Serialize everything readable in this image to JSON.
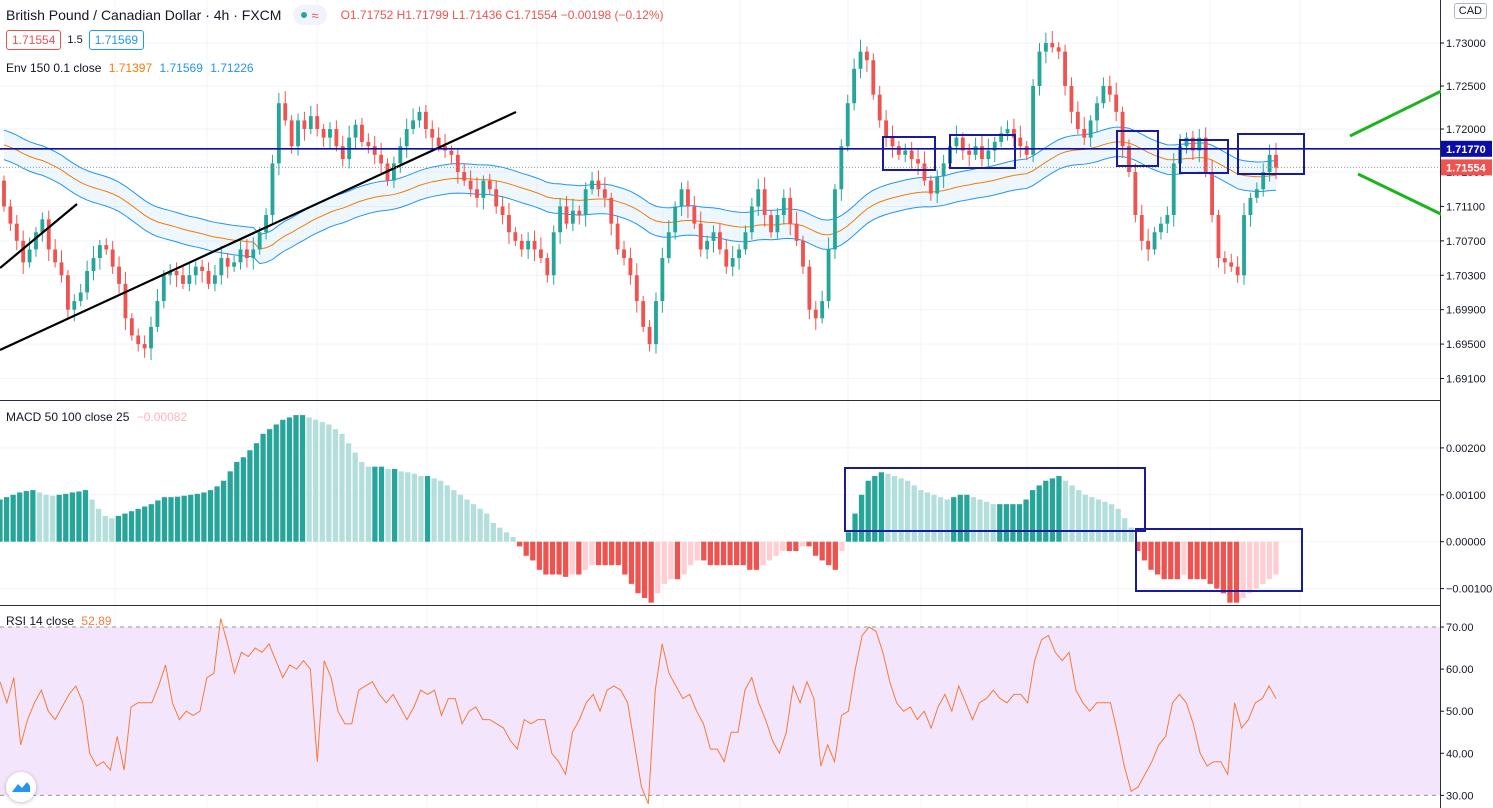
{
  "header": {
    "symbol": "British Pound / Canadian Dollar · 4h · FXCM",
    "ohlc": "O1.71752  H1.71799  L1.71436  C1.71554  −0.00198 (−0.12%)",
    "sell_price": "1.71554",
    "spread": "1.5",
    "buy_price": "1.71569",
    "currency": "CAD"
  },
  "indicators": {
    "env": {
      "name": "Env 150 0.1 close",
      "v1": "1.71397",
      "v2": "1.71569",
      "v3": "1.71226"
    },
    "macd": {
      "name": "MACD 50 100 close 25",
      "value": "−0.00082"
    },
    "rsi": {
      "name": "RSI 14 close",
      "value": "52.89"
    }
  },
  "colors": {
    "up": "#26a69a",
    "down": "#ef5350",
    "up_light": "#b2dfdb",
    "down_light": "#ffcdd2",
    "env_mid": "#f57c00",
    "env_band": "#2196f3",
    "hline": "#0c0ca8",
    "box": "#1a1a9c",
    "trend": "#000000",
    "arrow": "#1bb51b",
    "rsi": "#f57c3c",
    "rsi_bg": "#f3e5fb"
  },
  "chart_data": [
    {
      "type": "candlestick",
      "title": "British Pound / Canadian Dollar · 4h · FXCM",
      "ylim": [
        1.6885,
        1.735
      ],
      "y_ticks": [
        "1.73000",
        "1.72500",
        "1.72000",
        "1.71500",
        "1.71100",
        "1.70700",
        "1.70300",
        "1.69900",
        "1.69500",
        "1.69100"
      ],
      "y_tick_values": [
        1.73,
        1.725,
        1.72,
        1.715,
        1.711,
        1.707,
        1.703,
        1.699,
        1.695,
        1.691
      ],
      "price_labels": [
        {
          "value": 1.7177,
          "text": "1.71770"
        },
        {
          "value": 1.71554,
          "text": "1.71554"
        }
      ],
      "candles_close": [
        1.711,
        1.709,
        1.707,
        1.7045,
        1.706,
        1.708,
        1.7095,
        1.706,
        1.7045,
        1.703,
        1.699,
        1.7,
        1.701,
        1.7035,
        1.705,
        1.7065,
        1.706,
        1.704,
        1.702,
        1.698,
        1.696,
        1.695,
        1.6945,
        1.697,
        1.7,
        1.703,
        1.7035,
        1.703,
        1.702,
        1.703,
        1.704,
        1.7035,
        1.702,
        1.703,
        1.705,
        1.704,
        1.7045,
        1.706,
        1.705,
        1.706,
        1.708,
        1.71,
        1.716,
        1.723,
        1.721,
        1.718,
        1.721,
        1.72,
        1.7215,
        1.72,
        1.719,
        1.72,
        1.718,
        1.7165,
        1.719,
        1.7205,
        1.7185,
        1.718,
        1.717,
        1.716,
        1.714,
        1.716,
        1.718,
        1.72,
        1.721,
        1.722,
        1.72,
        1.719,
        1.718,
        1.7175,
        1.717,
        1.715,
        1.714,
        1.713,
        1.712,
        1.714,
        1.713,
        1.711,
        1.71,
        1.708,
        1.707,
        1.706,
        1.707,
        1.706,
        1.705,
        1.703,
        1.708,
        1.711,
        1.709,
        1.7105,
        1.71,
        1.713,
        1.714,
        1.713,
        1.712,
        1.709,
        1.706,
        1.705,
        1.703,
        1.7,
        1.697,
        1.695,
        1.7,
        1.705,
        1.708,
        1.711,
        1.713,
        1.711,
        1.709,
        1.706,
        1.707,
        1.708,
        1.706,
        1.704,
        1.705,
        1.706,
        1.708,
        1.711,
        1.713,
        1.71,
        1.708,
        1.71,
        1.712,
        1.709,
        1.707,
        1.704,
        1.699,
        1.698,
        1.7,
        1.706,
        1.713,
        1.718,
        1.723,
        1.727,
        1.729,
        1.728,
        1.724,
        1.721,
        1.719,
        1.718,
        1.717,
        1.7175,
        1.7165,
        1.716,
        1.714,
        1.7125,
        1.7145,
        1.716,
        1.718,
        1.719,
        1.7175,
        1.717,
        1.718,
        1.7165,
        1.7175,
        1.7185,
        1.7195,
        1.72,
        1.719,
        1.718,
        1.717,
        1.725,
        1.729,
        1.73,
        1.7295,
        1.729,
        1.725,
        1.722,
        1.72,
        1.719,
        1.721,
        1.723,
        1.725,
        1.724,
        1.722,
        1.718,
        1.715,
        1.71,
        1.707,
        1.706,
        1.708,
        1.709,
        1.71,
        1.716,
        1.718,
        1.719,
        1.7175,
        1.719,
        1.715,
        1.71,
        1.705,
        1.7045,
        1.704,
        1.703,
        1.71,
        1.712,
        1.713,
        1.715,
        1.717,
        1.7155
      ],
      "envelope": {
        "ylim_text": "1.71397 / 1.71569 / 1.71226"
      },
      "annotations": [
        "horizontal line at 1.71770",
        "up trend lines",
        "consolidation boxes",
        "two green direction arrows"
      ]
    },
    {
      "type": "bar",
      "title": "MACD 50 100 close 25",
      "ylim": [
        -0.00135,
        0.003
      ],
      "y_ticks": [
        "0.00200",
        "0.00100",
        "0.00000",
        "−0.00100"
      ],
      "y_tick_values": [
        0.002,
        0.001,
        0.0,
        -0.001
      ],
      "values": [
        0.0009,
        0.00095,
        0.001,
        0.00105,
        0.00108,
        0.0011,
        0.00105,
        0.001,
        0.00098,
        0.001,
        0.00102,
        0.00105,
        0.00107,
        0.0011,
        0.0009,
        0.0007,
        0.00055,
        0.0005,
        0.00055,
        0.0006,
        0.00065,
        0.0007,
        0.00075,
        0.0008,
        0.00088,
        0.00095,
        0.00095,
        0.00096,
        0.00098,
        0.001,
        0.00102,
        0.00105,
        0.0011,
        0.00118,
        0.0013,
        0.0015,
        0.0017,
        0.0018,
        0.00195,
        0.0021,
        0.0023,
        0.0024,
        0.0025,
        0.0026,
        0.00265,
        0.0027,
        0.0027,
        0.00265,
        0.0026,
        0.00255,
        0.0025,
        0.0024,
        0.0023,
        0.0021,
        0.0019,
        0.0017,
        0.0016,
        0.0016,
        0.0016,
        0.00155,
        0.00155,
        0.0015,
        0.00148,
        0.00145,
        0.0014,
        0.0014,
        0.00135,
        0.0013,
        0.0012,
        0.0011,
        0.001,
        0.0009,
        0.0008,
        0.0007,
        0.0006,
        0.0004,
        0.0003,
        0.0002,
        0.0001,
        -0.0001,
        -0.0003,
        -0.0004,
        -0.0006,
        -0.0007,
        -0.0007,
        -0.0007,
        -0.00075,
        -0.0007,
        -0.0007,
        -0.0006,
        -0.0005,
        -0.0005,
        -0.0005,
        -0.0005,
        -0.0005,
        -0.0007,
        -0.0009,
        -0.0011,
        -0.0012,
        -0.0013,
        -0.0011,
        -0.0009,
        -0.0008,
        -0.0008,
        -0.0007,
        -0.0005,
        -0.0004,
        -0.0004,
        -0.0005,
        -0.0005,
        -0.0005,
        -0.0005,
        -0.0005,
        -0.0005,
        -0.0006,
        -0.0006,
        -0.0005,
        -0.0004,
        -0.0003,
        -0.0002,
        -0.0002,
        -0.0002,
        -0.0001,
        -0.0001,
        -0.0003,
        -0.0004,
        -0.0005,
        -0.0006,
        -0.0002,
        0.0002,
        0.0006,
        0.001,
        0.0013,
        0.0014,
        0.00148,
        0.00145,
        0.0014,
        0.00135,
        0.0013,
        0.0012,
        0.0011,
        0.00105,
        0.001,
        0.00095,
        0.0009,
        0.00095,
        0.001,
        0.001,
        0.00095,
        0.0009,
        0.00085,
        0.0008,
        0.0008,
        0.0008,
        0.0008,
        0.0008,
        0.0009,
        0.0011,
        0.0012,
        0.0013,
        0.00135,
        0.0014,
        0.0013,
        0.0012,
        0.0011,
        0.001,
        0.00095,
        0.0009,
        0.00085,
        0.0008,
        0.0007,
        0.0005,
        0.0003,
        -0.0002,
        -0.0004,
        -0.0006,
        -0.0007,
        -0.0008,
        -0.0008,
        -0.0008,
        -0.0007,
        -0.0008,
        -0.0008,
        -0.0008,
        -0.0009,
        -0.001,
        -0.0011,
        -0.0013,
        -0.0013,
        -0.0012,
        -0.0011,
        -0.001,
        -0.0009,
        -0.0008,
        -0.0007
      ]
    },
    {
      "type": "line",
      "title": "RSI 14 close",
      "ylim": [
        27,
        75
      ],
      "y_ticks": [
        "70.00",
        "60.00",
        "50.00",
        "40.00",
        "30.00"
      ],
      "y_tick_values": [
        70,
        60,
        50,
        40,
        30
      ],
      "band": [
        30,
        70
      ],
      "values": [
        57,
        52,
        58,
        42,
        48,
        52,
        55,
        50,
        48,
        51,
        54,
        56,
        52,
        40,
        37,
        38,
        36,
        44,
        36,
        51,
        52,
        52,
        52,
        56,
        61,
        52,
        48,
        50,
        49,
        50,
        58,
        59,
        72,
        66,
        59,
        64,
        63,
        65,
        64,
        66,
        62,
        58,
        61,
        60,
        62,
        60,
        38,
        62,
        58,
        50,
        47,
        47,
        55,
        56,
        57,
        54,
        52,
        54,
        51,
        48,
        51,
        55,
        54,
        55,
        49,
        53,
        53,
        47,
        50,
        51,
        48,
        48,
        47,
        46,
        43,
        41,
        48,
        47,
        48,
        48,
        40,
        38,
        35,
        45,
        48,
        52,
        54,
        50,
        55,
        56,
        55,
        52,
        42,
        32,
        28,
        55,
        66,
        59,
        56,
        53,
        54,
        50,
        47,
        41,
        41,
        38,
        45,
        45,
        55,
        58,
        52,
        48,
        43,
        40,
        45,
        56,
        52,
        57,
        53,
        37,
        42,
        38,
        49,
        50,
        60,
        68,
        70,
        69,
        64,
        57,
        52,
        50,
        51,
        48,
        50,
        46,
        51,
        54,
        50,
        56,
        52,
        48,
        52,
        53,
        55,
        53,
        52,
        54,
        54,
        52,
        62,
        67,
        68,
        64,
        62,
        64,
        55,
        52,
        50,
        52,
        52,
        52,
        45,
        37,
        31,
        32,
        35,
        38,
        42,
        44,
        52,
        54,
        52,
        47,
        40,
        37,
        38,
        38,
        35,
        52,
        46,
        48,
        52,
        53,
        56,
        53
      ]
    }
  ]
}
